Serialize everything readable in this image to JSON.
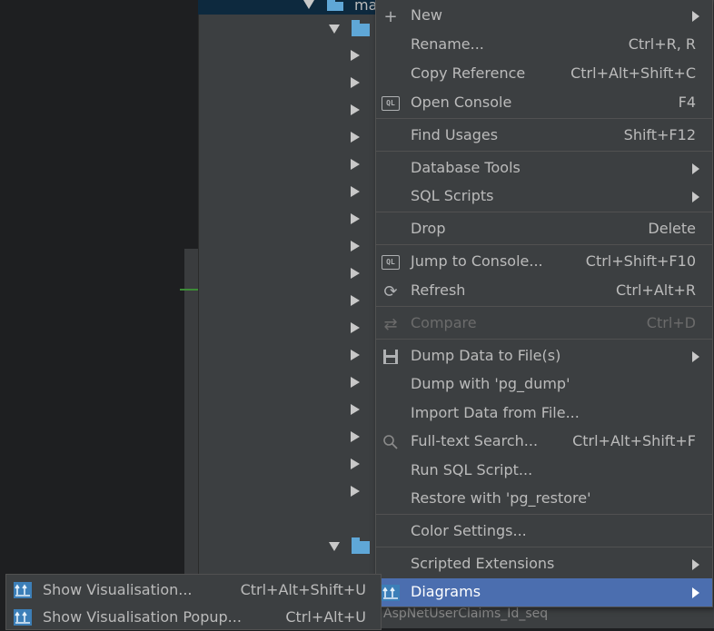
{
  "tree": {
    "root_label": "ma",
    "behind_row": "AspNetUserClaims_Id_seq"
  },
  "menu": {
    "items": [
      {
        "label": "New",
        "shortcut": "",
        "submenu": true,
        "icon": "plus-icon"
      },
      {
        "label": "Rename...",
        "shortcut": "Ctrl+R, R",
        "submenu": false,
        "icon": ""
      },
      {
        "label": "Copy Reference",
        "shortcut": "Ctrl+Alt+Shift+C",
        "submenu": false,
        "icon": ""
      },
      {
        "label": "Open Console",
        "shortcut": "F4",
        "submenu": false,
        "icon": "ql-console-icon"
      },
      {
        "label": "Find Usages",
        "shortcut": "Shift+F12",
        "submenu": false,
        "icon": ""
      },
      {
        "label": "Database Tools",
        "shortcut": "",
        "submenu": true,
        "icon": ""
      },
      {
        "label": "SQL Scripts",
        "shortcut": "",
        "submenu": true,
        "icon": ""
      },
      {
        "label": "Drop",
        "shortcut": "Delete",
        "submenu": false,
        "icon": ""
      },
      {
        "label": "Jump to Console...",
        "shortcut": "Ctrl+Shift+F10",
        "submenu": false,
        "icon": "ql-console-icon"
      },
      {
        "label": "Refresh",
        "shortcut": "Ctrl+Alt+R",
        "submenu": false,
        "icon": "refresh-icon"
      },
      {
        "label": "Compare",
        "shortcut": "Ctrl+D",
        "submenu": false,
        "icon": "compare-icon",
        "disabled": true
      },
      {
        "label": "Dump Data to File(s)",
        "shortcut": "",
        "submenu": true,
        "icon": "save-icon"
      },
      {
        "label": "Dump with 'pg_dump'",
        "shortcut": "",
        "submenu": false,
        "icon": ""
      },
      {
        "label": "Import Data from File...",
        "shortcut": "",
        "submenu": false,
        "icon": ""
      },
      {
        "label": "Full-text Search...",
        "shortcut": "Ctrl+Alt+Shift+F",
        "submenu": false,
        "icon": "search-icon"
      },
      {
        "label": "Run SQL Script...",
        "shortcut": "",
        "submenu": false,
        "icon": ""
      },
      {
        "label": "Restore with 'pg_restore'",
        "shortcut": "",
        "submenu": false,
        "icon": ""
      },
      {
        "label": "Color Settings...",
        "shortcut": "",
        "submenu": false,
        "icon": ""
      },
      {
        "label": "Scripted Extensions",
        "shortcut": "",
        "submenu": true,
        "icon": ""
      },
      {
        "label": "Diagrams",
        "shortcut": "",
        "submenu": true,
        "icon": "diagram-icon",
        "selected": true
      }
    ]
  },
  "submenu": {
    "items": [
      {
        "label": "Show Visualisation...",
        "shortcut": "Ctrl+Alt+Shift+U"
      },
      {
        "label": "Show Visualisation Popup...",
        "shortcut": "Ctrl+Alt+U"
      }
    ]
  },
  "colors": {
    "menu_bg": "#3c3f41",
    "selection": "#4b6eaf",
    "folder": "#5fa7d7",
    "editor_bg": "#1e1f21"
  }
}
